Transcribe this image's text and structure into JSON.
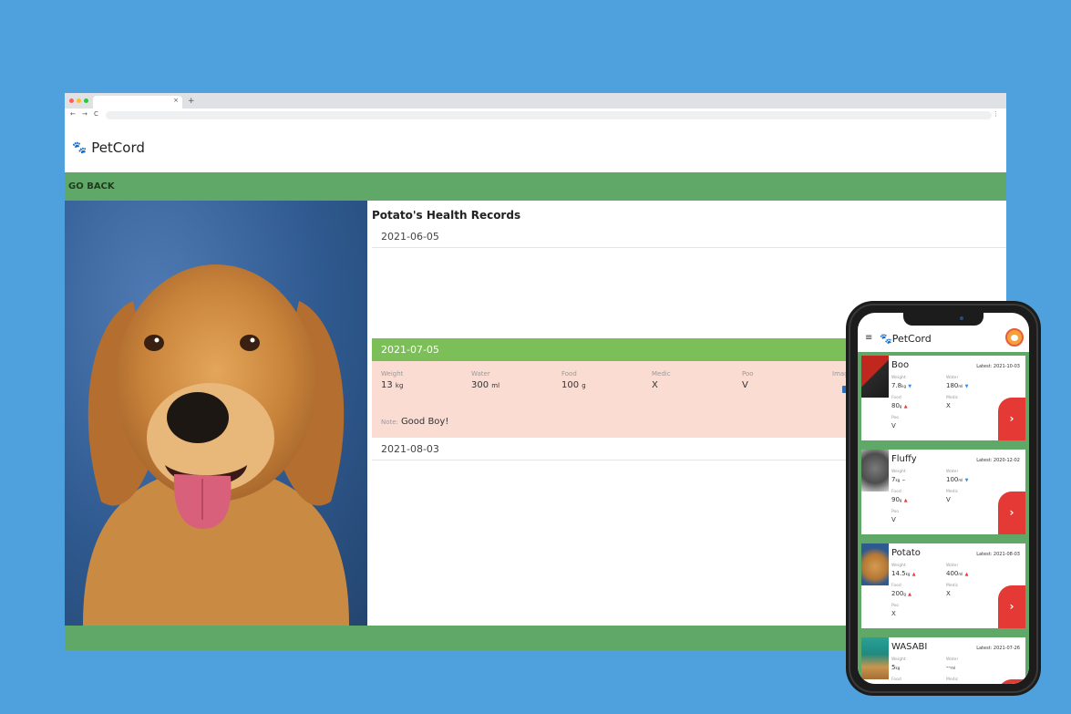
{
  "browser": {
    "dot_colors": [
      "#ff5f57",
      "#febc2e",
      "#28c840"
    ],
    "tab_close": "×",
    "new_tab": "+",
    "nav": {
      "back": "←",
      "forward": "→",
      "reload": "C"
    },
    "menu": "⋮"
  },
  "site": {
    "brand": "PetCord",
    "go_back": "GO BACK",
    "title": "Potato's Health Records",
    "records": [
      {
        "date": "2021-06-05"
      },
      {
        "date": "2021-07-05"
      },
      {
        "date": "2021-08-03"
      }
    ],
    "detail": {
      "weight": {
        "label": "Weight",
        "value": "13",
        "unit": "kg"
      },
      "water": {
        "label": "Water",
        "value": "300",
        "unit": "ml"
      },
      "food": {
        "label": "Food",
        "value": "100",
        "unit": "g"
      },
      "medic": {
        "label": "Medic",
        "value": "X"
      },
      "poo": {
        "label": "Poo",
        "value": "V"
      },
      "image": {
        "label": "Image"
      },
      "edit_icon": "✎",
      "note_label": "Note:",
      "note": "Good Boy!"
    }
  },
  "phone": {
    "menu": "≡",
    "brand": "PetCord",
    "chevron": "›",
    "pets": [
      {
        "name": "Boo",
        "latest": "Latest: 2021-10-03",
        "weight_label": "Weight",
        "weight": "7.8",
        "weight_unit": "kg",
        "weight_trend": "▼",
        "water_label": "Water",
        "water": "180",
        "water_unit": "ml",
        "water_trend": "▼",
        "food_label": "Food",
        "food": "80",
        "food_unit": "g",
        "food_trend": "▲",
        "medic_label": "Medic",
        "medic": "X",
        "poo_label": "Poo",
        "poo": "V"
      },
      {
        "name": "Fluffy",
        "latest": "Latest: 2020-12-02",
        "weight_label": "Weight",
        "weight": "7",
        "weight_unit": "kg",
        "weight_trend": "–",
        "water_label": "Water",
        "water": "100",
        "water_unit": "ml",
        "water_trend": "▼",
        "food_label": "Food",
        "food": "90",
        "food_unit": "g",
        "food_trend": "▲",
        "medic_label": "Medic",
        "medic": "V",
        "poo_label": "Poo",
        "poo": "V"
      },
      {
        "name": "Potato",
        "latest": "Latest: 2021-08-03",
        "weight_label": "Weight",
        "weight": "14.5",
        "weight_unit": "kg",
        "weight_trend": "▲",
        "water_label": "Water",
        "water": "400",
        "water_unit": "ml",
        "water_trend": "▲",
        "food_label": "Food",
        "food": "200",
        "food_unit": "g",
        "food_trend": "▲",
        "medic_label": "Medic",
        "medic": "X",
        "poo_label": "Poo",
        "poo": "X"
      },
      {
        "name": "WASABI",
        "latest": "Latest: 2021-07-26",
        "weight_label": "Weight",
        "weight": "5",
        "weight_unit": "kg",
        "weight_trend": "",
        "water_label": "Water",
        "water": "--",
        "water_unit": "ml",
        "water_trend": "",
        "food_label": "Food",
        "food": "",
        "food_unit": "",
        "food_trend": "",
        "medic_label": "Medic",
        "medic": "",
        "poo_label": "",
        "poo": ""
      }
    ]
  }
}
